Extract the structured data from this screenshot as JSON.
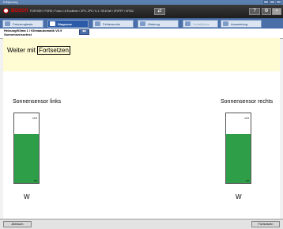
{
  "window": {
    "title": "ESI[tronic]"
  },
  "header": {
    "brand": "BOSCH",
    "vehicle": "FOR BEH / FORD / Fusio 1.6 Ecoflexer / 2PS, 2PS / 5.1 / 95.8 kW / 0F0FFF / 0F002",
    "help_button": "?",
    "colors": {
      "brand": "#e10000",
      "topbar": "#2b2b2b",
      "tabbar": "#4a6fa8",
      "active_tab": "#2a5aa8"
    }
  },
  "tabs": [
    {
      "label": "Fahrzeugtests",
      "icon": "car-icon"
    },
    {
      "label": "Diagnose",
      "icon": "check-icon",
      "active": true
    },
    {
      "label": "Fehlersuche",
      "icon": "car-search-icon"
    },
    {
      "label": "Wartung",
      "icon": "wrench-icon"
    },
    {
      "label": "Schaltpläne",
      "icon": "circuit-icon",
      "disabled": true
    },
    {
      "label": "Auswertung",
      "icon": "report-icon"
    }
  ],
  "breadcrumb": {
    "path": "Heizung/Klima 1 / Klimaautomatik V6.9",
    "page": "Sonnensensortest"
  },
  "instruction": {
    "prefix": "Weiter mit",
    "button": "Fortsetzen"
  },
  "gauges": [
    {
      "title": "Sonnensensor links",
      "max": "13.0",
      "min": "0.0",
      "fill_percent": 70,
      "unit": "W"
    },
    {
      "title": "Sonnensensor rechts",
      "max": "13.0",
      "min": "0.0",
      "fill_percent": 70,
      "unit": "W"
    }
  ],
  "footer": {
    "cancel_label": "Abbruch",
    "continue_label": "Fortsetzen"
  }
}
